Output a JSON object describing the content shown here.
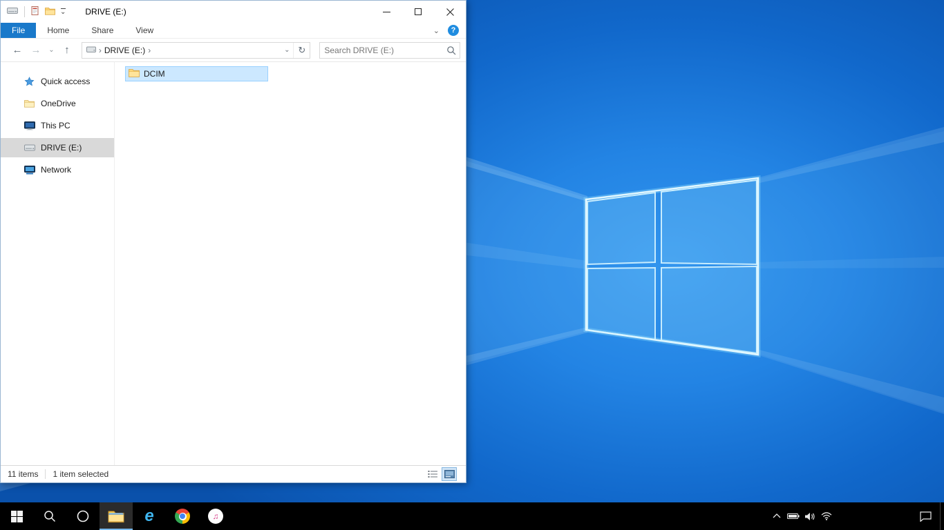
{
  "icons": {
    "back": "←",
    "forward": "→",
    "up": "↑",
    "refresh": "↻",
    "chevron_down": "⌄",
    "chevron_right": "›",
    "ribbon_collapse": "⌄",
    "help": "?",
    "ie_glyph": "e",
    "itunes_note": "♫"
  },
  "explorer": {
    "title": "DRIVE (E:)",
    "ribbon": {
      "file_tab": "File",
      "tabs": [
        "Home",
        "Share",
        "View"
      ]
    },
    "navbar": {
      "breadcrumb_root": "DRIVE (E:)",
      "search_placeholder": "Search DRIVE (E:)"
    },
    "sidebar": {
      "items": [
        {
          "label": "Quick access"
        },
        {
          "label": "OneDrive"
        },
        {
          "label": "This PC"
        },
        {
          "label": "DRIVE (E:)",
          "selected": true
        },
        {
          "label": "Network"
        }
      ]
    },
    "content": {
      "folders": [
        {
          "label": "DCIM",
          "selected": true
        }
      ]
    },
    "statusbar": {
      "count": "11 items",
      "selection": "1 item selected"
    }
  },
  "taskbar": {
    "buttons": [
      "start",
      "search",
      "cortana",
      "file-explorer",
      "internet-explorer",
      "chrome",
      "itunes"
    ],
    "active_button": "file-explorer",
    "tray": [
      "hidden-icons",
      "battery",
      "volume",
      "network",
      "action-center"
    ]
  },
  "colors": {
    "accent_blue": "#1979ca",
    "selection_bg": "#cce8ff",
    "selection_border": "#99d1ff",
    "sidebar_selected": "#d9d9d9",
    "taskbar_bg": "#000000",
    "wallpaper_blue": "#1168cb"
  }
}
